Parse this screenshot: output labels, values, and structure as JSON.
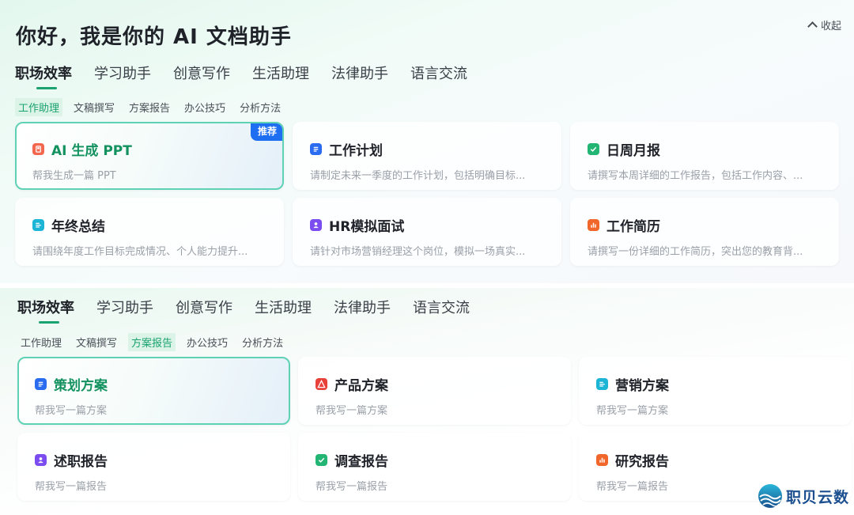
{
  "panel1": {
    "title": "你好，我是你的 AI 文档助手",
    "collapse_label": "收起",
    "main_tabs": [
      {
        "label": "职场效率",
        "active": true
      },
      {
        "label": "学习助手",
        "active": false
      },
      {
        "label": "创意写作",
        "active": false
      },
      {
        "label": "生活助理",
        "active": false
      },
      {
        "label": "法律助手",
        "active": false
      },
      {
        "label": "语言交流",
        "active": false
      }
    ],
    "sub_tabs": [
      {
        "label": "工作助理",
        "active": true
      },
      {
        "label": "文稿撰写",
        "active": false
      },
      {
        "label": "方案报告",
        "active": false
      },
      {
        "label": "办公技巧",
        "active": false
      },
      {
        "label": "分析方法",
        "active": false
      }
    ],
    "cards": [
      {
        "title": "AI 生成 PPT",
        "desc": "帮我生成一篇 PPT",
        "icon": "ppt-icon",
        "color": "#f4674f",
        "badge": "推荐",
        "active": true
      },
      {
        "title": "工作计划",
        "desc": "请制定未来一季度的工作计划，包括明确目标...",
        "icon": "doc-icon",
        "color": "#2a6cf0",
        "active": false
      },
      {
        "title": "日周月报",
        "desc": "请撰写本周详细的工作报告，包括工作内容、...",
        "icon": "check-icon",
        "color": "#22b573",
        "active": false
      },
      {
        "title": "年终总结",
        "desc": "请围绕年度工作目标完成情况、个人能力提升...",
        "icon": "summary-icon",
        "color": "#1cb5d6",
        "active": false
      },
      {
        "title": "HR模拟面试",
        "desc": "请针对市场营销经理这个岗位，模拟一场真实...",
        "icon": "person-icon",
        "color": "#7b4cf0",
        "active": false
      },
      {
        "title": "工作简历",
        "desc": "请撰写一份详细的工作简历，突出您的教育背...",
        "icon": "chart-icon",
        "color": "#f0662b",
        "active": false
      }
    ]
  },
  "panel2": {
    "main_tabs": [
      {
        "label": "职场效率",
        "active": true
      },
      {
        "label": "学习助手",
        "active": false
      },
      {
        "label": "创意写作",
        "active": false
      },
      {
        "label": "生活助理",
        "active": false
      },
      {
        "label": "法律助手",
        "active": false
      },
      {
        "label": "语言交流",
        "active": false
      }
    ],
    "sub_tabs": [
      {
        "label": "工作助理",
        "active": false
      },
      {
        "label": "文稿撰写",
        "active": false
      },
      {
        "label": "方案报告",
        "active": true
      },
      {
        "label": "办公技巧",
        "active": false
      },
      {
        "label": "分析方法",
        "active": false
      }
    ],
    "cards": [
      {
        "title": "策划方案",
        "desc": "帮我写一篇方案",
        "icon": "doc-icon",
        "color": "#2a6cf0",
        "active": true
      },
      {
        "title": "产品方案",
        "desc": "帮我写一篇方案",
        "icon": "pdf-icon",
        "color": "#e8413a",
        "active": false
      },
      {
        "title": "营销方案",
        "desc": "帮我写一篇方案",
        "icon": "summary-icon",
        "color": "#1cb5d6",
        "active": false
      },
      {
        "title": "述职报告",
        "desc": "帮我写一篇报告",
        "icon": "person-icon",
        "color": "#7b4cf0",
        "active": false
      },
      {
        "title": "调查报告",
        "desc": "帮我写一篇报告",
        "icon": "check-icon",
        "color": "#22b573",
        "active": false
      },
      {
        "title": "研究报告",
        "desc": "帮我写一篇报告",
        "icon": "chart-icon",
        "color": "#f0662b",
        "active": false
      }
    ]
  },
  "watermark": {
    "text": "职贝云数"
  }
}
